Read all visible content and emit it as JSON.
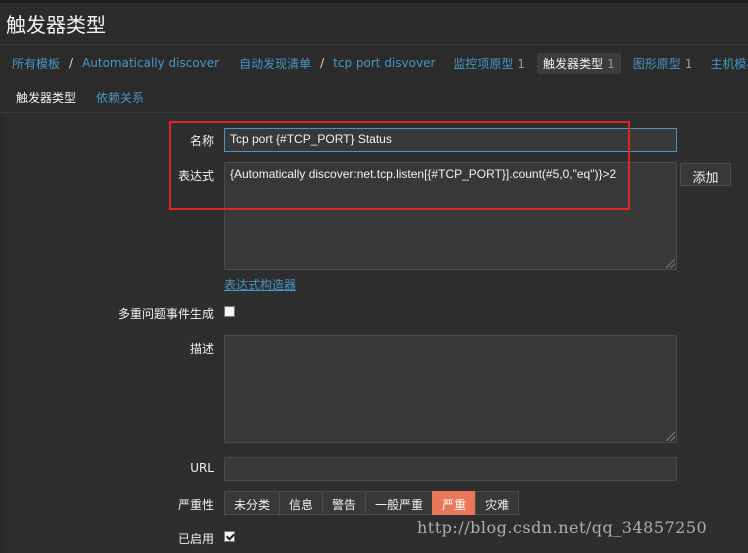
{
  "page": {
    "title": "触发器类型"
  },
  "breadcrumbs": [
    {
      "label": "所有模板"
    },
    {
      "label": "Automatically discover"
    },
    {
      "label": "自动发现清单"
    },
    {
      "label": "tcp port disvover"
    },
    {
      "label": "监控项原型",
      "count": "1"
    },
    {
      "label": "触发器类型",
      "count": "1"
    },
    {
      "label": "图形原型",
      "count": "1"
    },
    {
      "label": "主机模板"
    }
  ],
  "tabs": [
    {
      "label": "触发器类型"
    },
    {
      "label": "依赖关系"
    }
  ],
  "form": {
    "name_label": "名称",
    "name_value": "Tcp port {#TCP_PORT} Status",
    "expression_label": "表达式",
    "expression_value": "{Automatically discover:net.tcp.listen[{#TCP_PORT}].count(#5,0,\"eq\")}>2",
    "add_button": "添加",
    "expression_builder_link": "表达式构造器",
    "multiple_events_label": "多重问题事件生成",
    "multiple_events_checked": false,
    "description_label": "描述",
    "description_value": "",
    "url_label": "URL",
    "url_value": "",
    "severity_label": "严重性",
    "severity_options": [
      "未分类",
      "信息",
      "警告",
      "一般严重",
      "严重",
      "灾难"
    ],
    "severity_selected": "严重",
    "enabled_label": "已启用",
    "enabled_checked": true
  },
  "colors": {
    "accent": "#4796c4",
    "severity_selected": "#e97659",
    "annotation": "#e0262a"
  },
  "watermark": "http://blog.csdn.net/qq_34857250"
}
